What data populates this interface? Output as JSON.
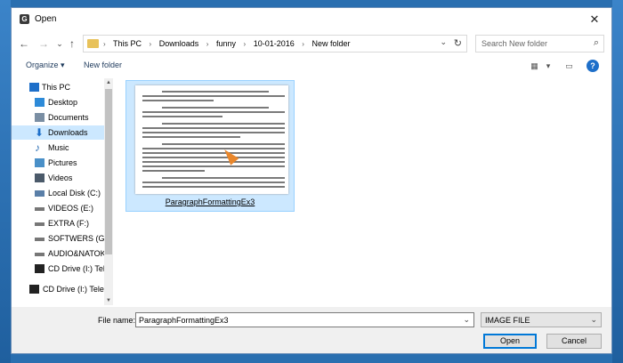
{
  "window": {
    "title": "Open"
  },
  "nav": {
    "back": "←",
    "forward": "→",
    "recent": "⌄",
    "up": "↑",
    "breadcrumbs": [
      "This PC",
      "Downloads",
      "funny",
      "10-01-2016",
      "New folder"
    ],
    "search_placeholder": "Search New folder"
  },
  "toolbar": {
    "organize": "Organize ▾",
    "new_folder": "New folder"
  },
  "sidebar": {
    "items": [
      {
        "label": "This PC",
        "icon": "computer-icon",
        "color": "#1e6fc9"
      },
      {
        "label": "Desktop",
        "icon": "desktop-icon",
        "color": "#2d8ad8"
      },
      {
        "label": "Documents",
        "icon": "documents-icon",
        "color": "#7a8ea3"
      },
      {
        "label": "Downloads",
        "icon": "downloads-icon",
        "color": "#1e6fc9"
      },
      {
        "label": "Music",
        "icon": "music-icon",
        "color": "#2d6fb5"
      },
      {
        "label": "Pictures",
        "icon": "pictures-icon",
        "color": "#4a90c8"
      },
      {
        "label": "Videos",
        "icon": "videos-icon",
        "color": "#4b5a6a"
      },
      {
        "label": "Local Disk (C:)",
        "icon": "local-disk-icon",
        "color": "#5a7fa8"
      },
      {
        "label": "VIDEOS (E:)",
        "icon": "drive-icon",
        "color": "#777777"
      },
      {
        "label": "EXTRA (F:)",
        "icon": "drive-icon",
        "color": "#777777"
      },
      {
        "label": "SOFTWERS (G:)",
        "icon": "drive-icon",
        "color": "#777777"
      },
      {
        "label": "AUDIO&NATOK",
        "icon": "drive-icon",
        "color": "#777777"
      },
      {
        "label": "CD Drive (I:) Tele",
        "icon": "cd-drive-icon",
        "color": "#222222"
      },
      {
        "label": "CD Drive (I:) Telet",
        "icon": "cd-drive-icon",
        "color": "#222222"
      }
    ],
    "selected": "Downloads"
  },
  "files": [
    {
      "name": "ParagraphFormattingEx3"
    }
  ],
  "footer": {
    "file_name_label": "File name:",
    "file_name_value": "ParagraphFormattingEx3",
    "file_type": "IMAGE FILE",
    "open": "Open",
    "cancel": "Cancel"
  },
  "colors": {
    "accent": "#0078d7",
    "selection": "#cce8ff",
    "folder": "#e8c25a"
  }
}
